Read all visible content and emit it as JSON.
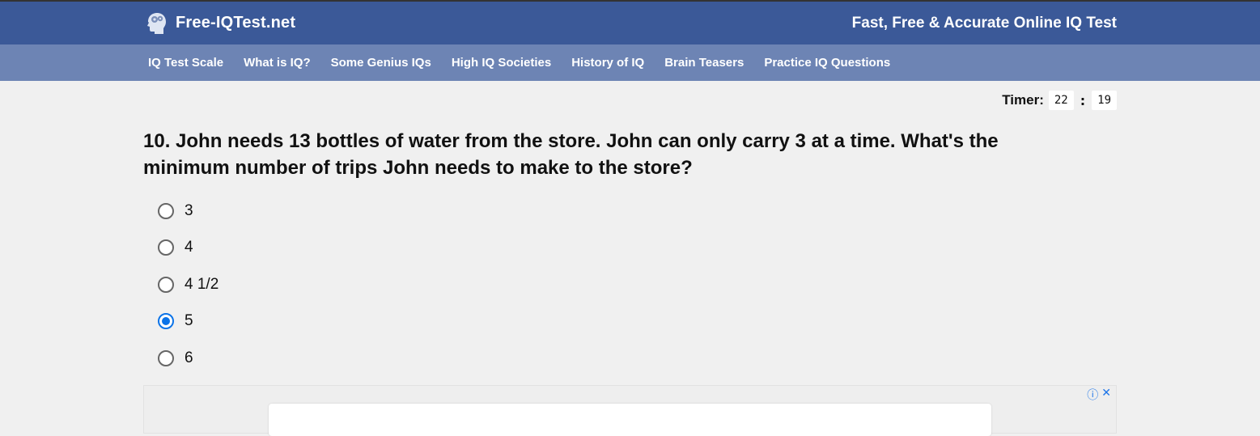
{
  "header": {
    "brand": "Free-IQTest.net",
    "tagline": "Fast, Free & Accurate Online IQ Test",
    "logo_icon": "brain-head-icon"
  },
  "nav": {
    "items": [
      {
        "label": "IQ Test Scale"
      },
      {
        "label": "What is IQ?"
      },
      {
        "label": "Some Genius IQs"
      },
      {
        "label": "High IQ Societies"
      },
      {
        "label": "History of IQ"
      },
      {
        "label": "Brain Teasers"
      },
      {
        "label": "Practice IQ Questions"
      }
    ]
  },
  "timer": {
    "label": "Timer:",
    "minutes": "22",
    "separator": ":",
    "seconds": "19"
  },
  "question": {
    "text": "10. John needs 13 bottles of water from the store. John can only carry 3 at a time. What's the minimum number of trips John needs to make to the store?"
  },
  "options": [
    {
      "label": "3",
      "checked": false
    },
    {
      "label": "4",
      "checked": false
    },
    {
      "label": "4 1/2",
      "checked": false
    },
    {
      "label": "5",
      "checked": true
    },
    {
      "label": "6",
      "checked": false
    }
  ],
  "ad": {
    "info_icon": "info-icon",
    "close_icon": "close-icon",
    "info_glyph": "ⓘ",
    "close_glyph": "✕"
  },
  "colors": {
    "header_bg": "#3b5998",
    "nav_bg": "#6d84b4",
    "radio_checked": "#0b73e8",
    "page_bg": "#f0f0f0"
  }
}
